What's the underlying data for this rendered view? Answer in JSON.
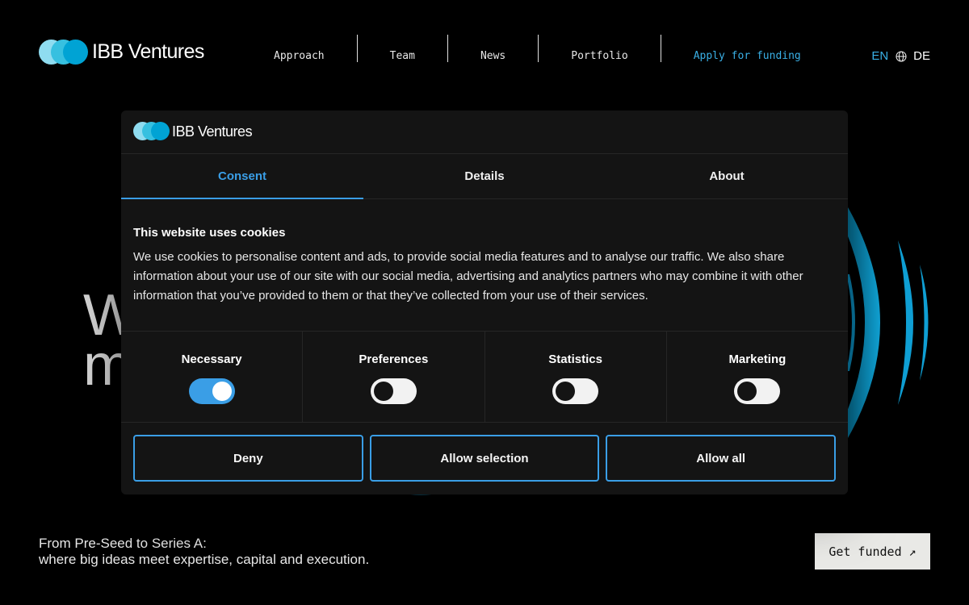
{
  "brand": {
    "name": "IBB Ventures"
  },
  "nav": {
    "items": [
      "Approach",
      "Team",
      "News",
      "Portfolio"
    ],
    "apply": "Apply for funding"
  },
  "lang": {
    "current": "EN",
    "other": "DE"
  },
  "hero": {
    "title_line1": "W",
    "title_line2": "m",
    "tagline_line1": "From Pre-Seed to Series A:",
    "tagline_line2": "where big ideas meet expertise, capital and execution.",
    "cta": "Get funded ↗"
  },
  "cookie": {
    "tabs": [
      "Consent",
      "Details",
      "About"
    ],
    "active_tab": "Consent",
    "title": "This website uses cookies",
    "text": "We use cookies to personalise content and ads, to provide social media features and to analyse our traffic. We also share information about your use of our site with our social media, advertising and analytics partners who may combine it with other information that you’ve provided to them or that they’ve collected from your use of their services.",
    "categories": [
      {
        "label": "Necessary",
        "enabled": true
      },
      {
        "label": "Preferences",
        "enabled": false
      },
      {
        "label": "Statistics",
        "enabled": false
      },
      {
        "label": "Marketing",
        "enabled": false
      }
    ],
    "buttons": {
      "deny": "Deny",
      "allow_selection": "Allow selection",
      "allow_all": "Allow all"
    }
  },
  "colors": {
    "accent": "#3a9ee6",
    "link": "#3ab0e6",
    "brand_light": "#8fdcf0",
    "brand_mid": "#37c0e0",
    "brand_dark": "#00a3d4",
    "background": "#000000",
    "dialog_bg": "#141414"
  },
  "icons": {
    "language": "globe-icon",
    "cta": "arrow-up-right-icon"
  }
}
